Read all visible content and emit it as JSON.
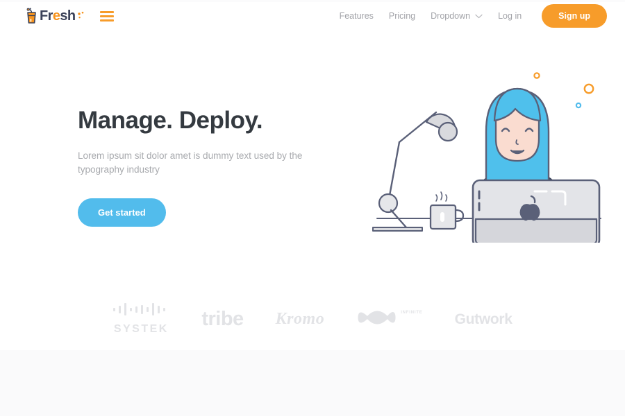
{
  "brand": {
    "name_dark_1": "Fr",
    "name_orange": "e",
    "name_dark_2": "sh",
    "full_name": "Fresh",
    "logo_icon": "juice-glass-icon",
    "menu_icon": "hamburger-menu-icon",
    "colors": {
      "navy": "#3b4259",
      "orange": "#f7941e"
    }
  },
  "nav": {
    "links": [
      {
        "label": "Features",
        "has_caret": false
      },
      {
        "label": "Pricing",
        "has_caret": false
      },
      {
        "label": "Dropdown",
        "has_caret": true,
        "caret_icon": "chevron-down-icon"
      },
      {
        "label": "Log in",
        "has_caret": false
      }
    ],
    "signup_label": "Sign up",
    "signup_color": "#f79c2a",
    "link_color": "#a2a3a8"
  },
  "hero": {
    "title": "Manage. Deploy.",
    "subtitle": "Lorem ipsum sit dolor amet is dummy text used by the typography industry",
    "cta_label": "Get started",
    "cta_color": "#52bcec",
    "title_color": "#343a40",
    "subtitle_color": "#a7a9ad",
    "illustration": {
      "name": "woman-at-laptop-illustration",
      "hair_color": "#4fc0ec",
      "skin_color": "#fadcd0",
      "shirt_color": "#353e55",
      "outline_color": "#5a6078",
      "laptop_color": "#e3e4e8",
      "accent_circles": [
        {
          "name": "orange-ring-small",
          "color": "#f79c2a"
        },
        {
          "name": "orange-ring-large",
          "color": "#f79c2a"
        },
        {
          "name": "blue-ring-small",
          "color": "#52bcec"
        }
      ]
    }
  },
  "partners": {
    "logos": [
      {
        "name": "SYSTEK",
        "icon": "waveform-bars-icon"
      },
      {
        "name": "tribe",
        "icon": ""
      },
      {
        "name": "Kromo",
        "icon": ""
      },
      {
        "name": "INFINITE",
        "icon": "infinity-icon"
      },
      {
        "name": "Gutwork",
        "icon": ""
      }
    ],
    "logo_color": "#e2e3e6"
  },
  "bottom_band": {
    "color": "#fafafb"
  }
}
